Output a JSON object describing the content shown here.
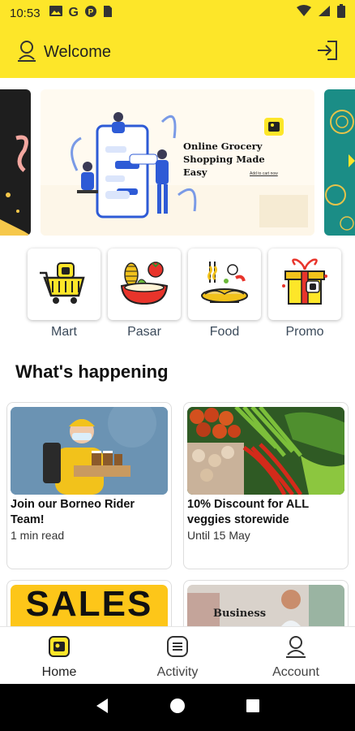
{
  "status_bar": {
    "time": "10:53",
    "icons": [
      "gallery-icon",
      "google-icon",
      "gpay-icon",
      "sim-card-icon"
    ],
    "right_icons": [
      "wifi-icon",
      "signal-icon",
      "battery-icon"
    ]
  },
  "app_bar": {
    "title": "Welcome",
    "left_icon": "user-icon",
    "right_icon": "logout-icon",
    "color": "#fde629"
  },
  "banner": {
    "headline": "Online Grocery Shopping Made Easy",
    "sub": "Add to cart now"
  },
  "categories": [
    {
      "label": "Mart",
      "icon": "shopping-basket-icon"
    },
    {
      "label": "Pasar",
      "icon": "vegetables-bowl-icon"
    },
    {
      "label": "Food",
      "icon": "noodles-icon"
    },
    {
      "label": "Promo",
      "icon": "gift-box-icon"
    }
  ],
  "section": {
    "title": "What's happening"
  },
  "cards": [
    {
      "title": "Join our Borneo Rider Team!",
      "sub": "1 min read"
    },
    {
      "title": "10% Discount for ALL veggies storewide",
      "sub": "Until 15 May"
    },
    {
      "title": "SALES",
      "sub": ""
    },
    {
      "title": "Business",
      "sub": ""
    }
  ],
  "bottom_nav": [
    {
      "label": "Home",
      "icon": "home-icon",
      "active": true
    },
    {
      "label": "Activity",
      "icon": "activity-icon",
      "active": false
    },
    {
      "label": "Account",
      "icon": "account-icon",
      "active": false
    }
  ]
}
